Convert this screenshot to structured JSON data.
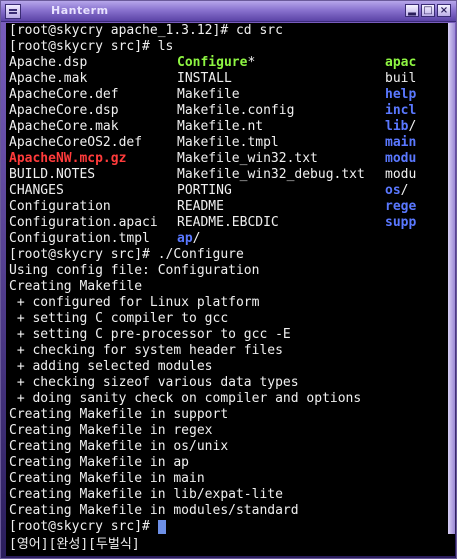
{
  "window": {
    "title": "Hanterm"
  },
  "colors": {
    "exec": "#8ef542",
    "dir": "#5a78ff",
    "archive": "#ff3b3b",
    "text": "#f0f0f0"
  },
  "terminal": {
    "cmd_cd": "[root@skycry apache_1.3.12]# cd src",
    "cmd_ls": "[root@skycry src]# ls",
    "ls": {
      "col1": [
        "Apache.dsp",
        "Apache.mak",
        "ApacheCore.def",
        "ApacheCore.dsp",
        "ApacheCore.mak",
        "ApacheCoreOS2.def",
        "ApacheNW.mcp.gz",
        "BUILD.NOTES",
        "CHANGES",
        "Configuration",
        "Configuration.apaci",
        "Configuration.tmpl"
      ],
      "col2": [
        "Configure",
        "INSTALL",
        "Makefile",
        "Makefile.config",
        "Makefile.nt",
        "Makefile.tmpl",
        "Makefile_win32.txt",
        "Makefile_win32_debug.txt",
        "PORTING",
        "README",
        "README.EBCDIC",
        "ap"
      ],
      "col2_suffix": [
        "*",
        "",
        "",
        "",
        "",
        "",
        "",
        "",
        "",
        "",
        "",
        "/"
      ],
      "col3": [
        "apac",
        "buil",
        "help",
        "incl",
        "lib",
        "main",
        "modu",
        "modu",
        "os",
        "rege",
        "supp"
      ],
      "col3_suffix": [
        "",
        "",
        "",
        "",
        "/",
        "",
        "",
        "",
        "/",
        "",
        ""
      ]
    },
    "output": [
      "[root@skycry src]# ./Configure",
      "Using config file: Configuration",
      "Creating Makefile",
      " + configured for Linux platform",
      " + setting C compiler to gcc",
      " + setting C pre-processor to gcc -E",
      " + checking for system header files",
      " + adding selected modules",
      " + checking sizeof various data types",
      " + doing sanity check on compiler and options",
      "Creating Makefile in support",
      "Creating Makefile in regex",
      "Creating Makefile in os/unix",
      "Creating Makefile in ap",
      "Creating Makefile in main",
      "Creating Makefile in lib/expat-lite",
      "Creating Makefile in modules/standard"
    ],
    "prompt": "[root@skycry src]# "
  },
  "status": {
    "text": "[영어][완성][두벌식]"
  }
}
